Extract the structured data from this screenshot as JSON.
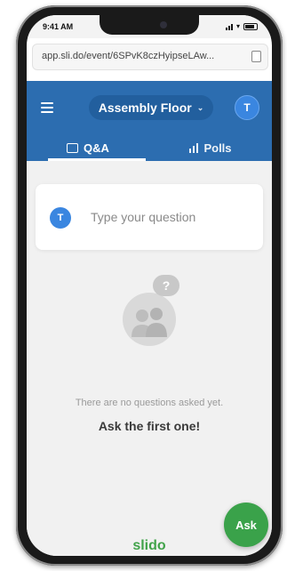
{
  "status": {
    "time": "9:41 AM"
  },
  "browser": {
    "url": "app.sli.do/event/6SPvK8czHyipseLAw..."
  },
  "header": {
    "event_name": "Assembly Floor",
    "avatar_initial": "T",
    "color": "#2c6db0"
  },
  "tabs": [
    {
      "label": "Q&A",
      "icon": "speech-bubble-icon",
      "active": true
    },
    {
      "label": "Polls",
      "icon": "bar-chart-icon",
      "active": false
    }
  ],
  "ask_card": {
    "avatar_initial": "T",
    "placeholder": "Type your question"
  },
  "empty_state": {
    "icon": "people-question-icon",
    "message": "There are no questions asked yet.",
    "cta": "Ask the first one!"
  },
  "footer": {
    "brand": "slido"
  },
  "fab": {
    "label": "Ask",
    "color": "#3aa24a"
  }
}
